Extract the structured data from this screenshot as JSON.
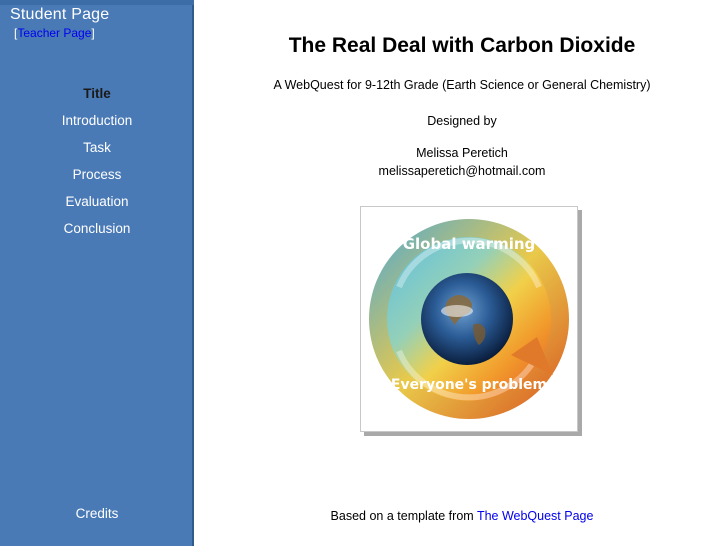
{
  "sidebar": {
    "student_page": "Student Page",
    "teacher_bracket_open": "[",
    "teacher_link": "Teacher Page",
    "teacher_bracket_close": "]",
    "items": [
      {
        "label": "Title",
        "current": true
      },
      {
        "label": "Introduction"
      },
      {
        "label": "Task"
      },
      {
        "label": "Process"
      },
      {
        "label": "Evaluation"
      },
      {
        "label": "Conclusion"
      }
    ],
    "credits": "Credits",
    "colors": {
      "background": "#4a7ab6",
      "link": "#ffffff",
      "current": "#1a1a1a"
    }
  },
  "main": {
    "title": "The Real Deal with Carbon Dioxide",
    "subtitle": "A WebQuest for 9-12th Grade (Earth Science or General Chemistry)",
    "designed_by": "Designed by",
    "author_name": "Melissa Peretich",
    "author_email": "melissaperetich@hotmail.com",
    "figure": {
      "top_text": "Global warming",
      "bottom_text": "Everyone's problem"
    },
    "footer_prefix": "Based on a template from ",
    "footer_link": "The WebQuest Page"
  }
}
